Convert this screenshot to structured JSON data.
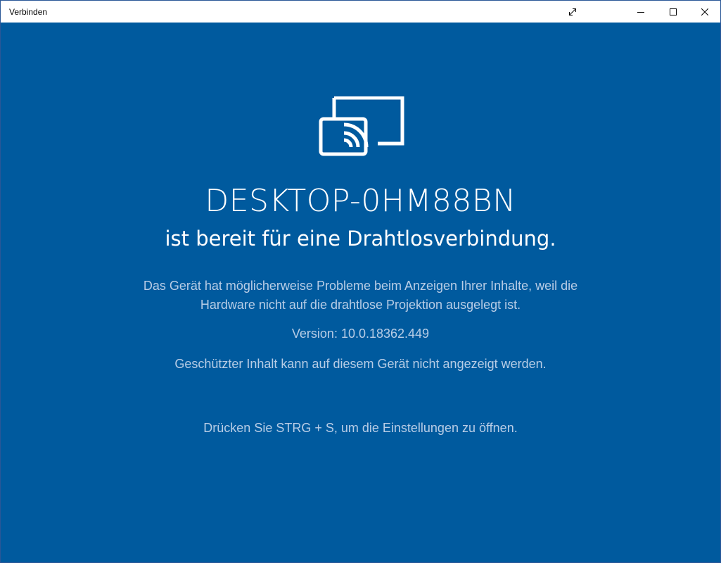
{
  "window": {
    "title": "Verbinden"
  },
  "main": {
    "device_name": "DESKTOP-0HM88BN",
    "ready_text": "ist bereit für eine Drahtlosverbindung.",
    "warning_line1": "Das Gerät hat möglicherweise Probleme beim Anzeigen Ihrer Inhalte, weil die",
    "warning_line2": "Hardware nicht auf die drahtlose Projektion ausgelegt ist.",
    "version": "Version: 10.0.18362.449",
    "protected_content": "Geschützter Inhalt kann auf diesem Gerät nicht angezeigt werden.",
    "settings_hint": "Drücken Sie STRG + S, um die Einstellungen zu öffnen."
  },
  "icons": {
    "app": "cast-icon",
    "expand": "expand-icon",
    "minimize": "minimize-icon",
    "maximize": "maximize-icon",
    "close": "close-icon"
  },
  "colors": {
    "background": "#005a9e",
    "text": "#ffffff",
    "secondary_text": "#b8cde6",
    "titlebar": "#ffffff"
  }
}
